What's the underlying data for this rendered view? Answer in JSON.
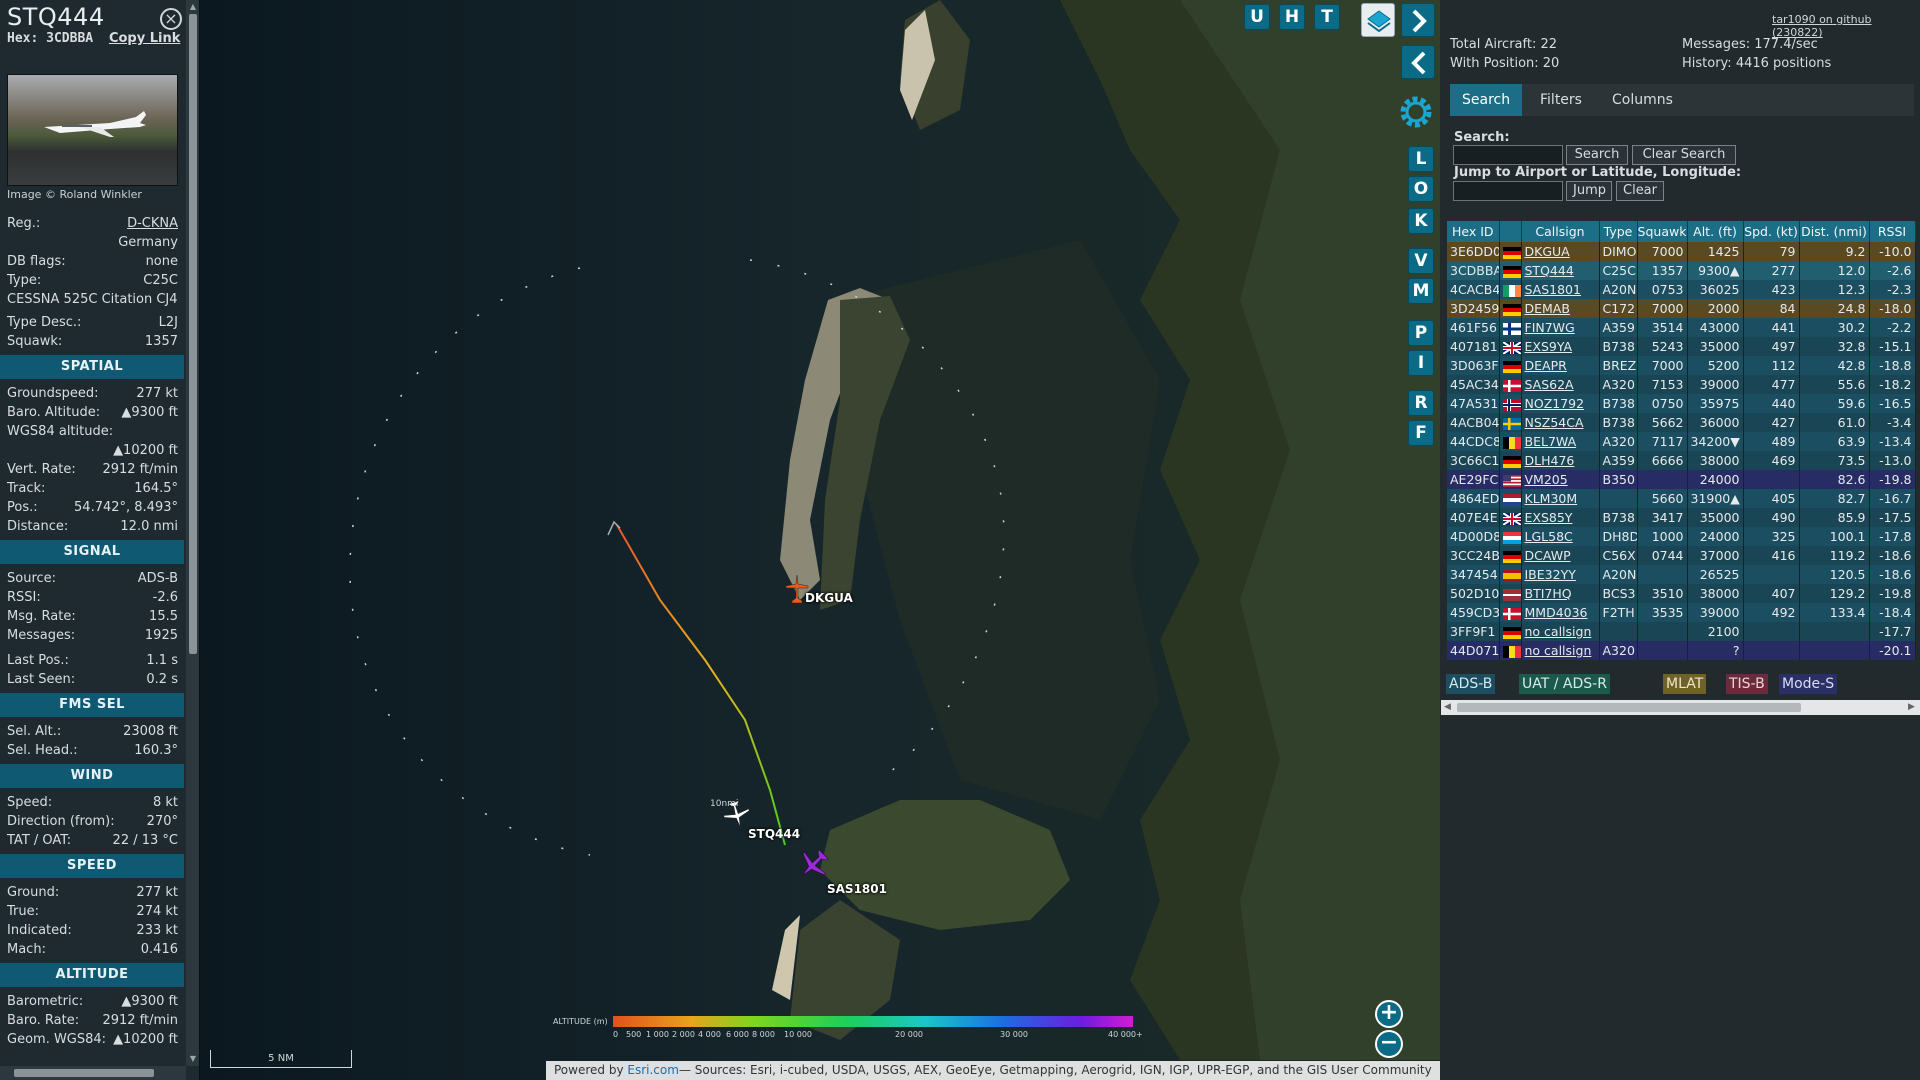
{
  "info": {
    "callsign": "STQ444",
    "hex_label": "Hex:",
    "hex": "3CDBBA",
    "copy_link": "Copy Link",
    "photo_credit": "Image © Roland Winkler",
    "rows_top": [
      {
        "k": "Reg.:",
        "v": "D-CKNA",
        "link": true
      },
      {
        "k": "",
        "v": "Germany"
      },
      {
        "k": "DB flags:",
        "v": "none"
      },
      {
        "k": "Type:",
        "v": "C25C"
      },
      {
        "k": "CESSNA 525C Citation CJ4",
        "v": ""
      },
      {
        "k": "Type Desc.:",
        "v": "L2J"
      },
      {
        "k": "Squawk:",
        "v": "1357"
      }
    ],
    "sections": [
      {
        "title": "SPATIAL",
        "rows": [
          {
            "k": "Groundspeed:",
            "v": "277 kt"
          },
          {
            "k": "Baro. Altitude:",
            "v": "▲9300 ft"
          },
          {
            "k": "WGS84 altitude:",
            "v": ""
          },
          {
            "k": "",
            "v": "▲10200 ft"
          },
          {
            "k": "Vert. Rate:",
            "v": "2912 ft/min"
          },
          {
            "k": "Track:",
            "v": "164.5°"
          },
          {
            "k": "Pos.:",
            "v": "54.742°, 8.493°"
          },
          {
            "k": "Distance:",
            "v": "12.0 nmi"
          }
        ]
      },
      {
        "title": "SIGNAL",
        "rows": [
          {
            "k": "Source:",
            "v": "ADS-B"
          },
          {
            "k": "RSSI:",
            "v": "-2.6"
          },
          {
            "k": "Msg. Rate:",
            "v": "15.5"
          },
          {
            "k": "Messages:",
            "v": "1925"
          },
          {
            "k": "Last Pos.:",
            "v": "1.1 s"
          },
          {
            "k": "Last Seen:",
            "v": "0.2 s"
          }
        ]
      },
      {
        "title": "FMS SEL",
        "rows": [
          {
            "k": "Sel. Alt.:",
            "v": "23008 ft"
          },
          {
            "k": "Sel. Head.:",
            "v": "160.3°"
          }
        ]
      },
      {
        "title": "WIND",
        "rows": [
          {
            "k": "Speed:",
            "v": "8 kt"
          },
          {
            "k": "Direction (from):",
            "v": "270°"
          },
          {
            "k": "TAT / OAT:",
            "v": "22 / 13 °C"
          }
        ]
      },
      {
        "title": "SPEED",
        "rows": [
          {
            "k": "Ground:",
            "v": "277 kt"
          },
          {
            "k": "True:",
            "v": "274 kt"
          },
          {
            "k": "Indicated:",
            "v": "233 kt"
          },
          {
            "k": "Mach:",
            "v": "0.416"
          }
        ]
      },
      {
        "title": "ALTITUDE",
        "rows": [
          {
            "k": "Barometric:",
            "v": "▲9300 ft"
          },
          {
            "k": "Baro. Rate:",
            "v": "2912 ft/min"
          },
          {
            "k": "Geom. WGS84:",
            "v": "▲10200 ft"
          }
        ]
      }
    ]
  },
  "map": {
    "top_buttons": [
      "U",
      "H",
      "T"
    ],
    "side_buttons": [
      "L",
      "O",
      "K",
      "V",
      "M",
      "P",
      "I",
      "R",
      "F"
    ],
    "aircraft_labels": {
      "dkgua": "DKGUA",
      "stq444": "STQ444",
      "sas1801": "SAS1801"
    },
    "range_label": "10nmi",
    "scale": "5 NM",
    "altitude_legend_title": "ALTITUDE (m)",
    "altitude_ticks": [
      "0",
      "500",
      "1 000",
      "2 000",
      "4 000",
      "6 000",
      "8 000",
      "10 000",
      "20 000",
      "30 000",
      "40 000+"
    ],
    "attribution_prefix": "Powered by ",
    "attribution_link": "Esri.com",
    "attribution_rest": "— Sources: Esri, i-cubed, USDA, USGS, AEX, GeoEye, Getmapping, Aerogrid, IGN, IGP, UPR-EGP, and the GIS User Community",
    "zoom_in": "+",
    "zoom_out": "−",
    "colors": {
      "track_start": "#e8552a",
      "track_mid": "#e7b21c",
      "track_end": "#3fd11c",
      "dkgua_icon": "#e85a22",
      "sas_icon": "#9a2bd6"
    }
  },
  "right": {
    "github_link": "tar1090 on github (230822)",
    "total_aircraft": "Total Aircraft: 22",
    "with_position": "With Position: 20",
    "messages": "Messages: 177.4/sec",
    "history": "History: 4416 positions",
    "tabs": [
      "Search",
      "Filters",
      "Columns"
    ],
    "search_label": "Search:",
    "search_button": "Search",
    "clear_search_button": "Clear Search",
    "jump_label": "Jump to Airport or Latitude, Longitude:",
    "jump_button": "Jump",
    "clear_button": "Clear",
    "columns": [
      "Hex ID",
      "",
      "Callsign",
      "Type",
      "Squawk",
      "Alt. (ft)",
      "Spd. (kt)",
      "Dist. (nmi)",
      "RSSI"
    ],
    "rows": [
      {
        "hex": "3E6DD0",
        "flag": "de",
        "cs": "DKGUA",
        "type": "DIMO",
        "sq": "7000",
        "alt": "1425",
        "spd": "79",
        "dist": "9.2",
        "rssi": "-10.0",
        "cls": "other"
      },
      {
        "hex": "3CDBBA",
        "flag": "de",
        "cs": "STQ444",
        "type": "C25C",
        "sq": "1357",
        "alt": "9300▲",
        "spd": "277",
        "dist": "12.0",
        "rssi": "-2.6",
        "cls": "sel"
      },
      {
        "hex": "4CACB4",
        "flag": "ie",
        "cs": "SAS1801",
        "type": "A20N",
        "sq": "0753",
        "alt": "36025",
        "spd": "423",
        "dist": "12.3",
        "rssi": "-2.3",
        "cls": "adsb"
      },
      {
        "hex": "3D2459",
        "flag": "de",
        "cs": "DEMAB",
        "type": "C172",
        "sq": "7000",
        "alt": "2000",
        "spd": "84",
        "dist": "24.8",
        "rssi": "-18.0",
        "cls": "other"
      },
      {
        "hex": "461F56",
        "flag": "fi",
        "cs": "FIN7WG",
        "type": "A359",
        "sq": "3514",
        "alt": "43000",
        "spd": "441",
        "dist": "30.2",
        "rssi": "-2.2",
        "cls": "adsb"
      },
      {
        "hex": "407181",
        "flag": "gb",
        "cs": "EXS9YA",
        "type": "B738",
        "sq": "5243",
        "alt": "35000",
        "spd": "497",
        "dist": "32.8",
        "rssi": "-15.1",
        "cls": "adsb alt"
      },
      {
        "hex": "3D063F",
        "flag": "de",
        "cs": "DEAPR",
        "type": "BREZ",
        "sq": "7000",
        "alt": "5200",
        "spd": "112",
        "dist": "42.8",
        "rssi": "-18.8",
        "cls": "adsb"
      },
      {
        "hex": "45AC34",
        "flag": "dk",
        "cs": "SAS62A",
        "type": "A320",
        "sq": "7153",
        "alt": "39000",
        "spd": "477",
        "dist": "55.6",
        "rssi": "-18.2",
        "cls": "adsb alt"
      },
      {
        "hex": "47A531",
        "flag": "no",
        "cs": "NOZ1792",
        "type": "B738",
        "sq": "0750",
        "alt": "35975",
        "spd": "440",
        "dist": "59.6",
        "rssi": "-16.5",
        "cls": "adsb"
      },
      {
        "hex": "4ACB04",
        "flag": "se",
        "cs": "NSZ54CA",
        "type": "B738",
        "sq": "5662",
        "alt": "36000",
        "spd": "427",
        "dist": "61.0",
        "rssi": "-3.4",
        "cls": "adsb alt"
      },
      {
        "hex": "44CDC8",
        "flag": "be",
        "cs": "BEL7WA",
        "type": "A320",
        "sq": "7117",
        "alt": "34200▼",
        "spd": "489",
        "dist": "63.9",
        "rssi": "-13.4",
        "cls": "adsb"
      },
      {
        "hex": "3C66C1",
        "flag": "de",
        "cs": "DLH476",
        "type": "A359",
        "sq": "6666",
        "alt": "38000",
        "spd": "469",
        "dist": "73.5",
        "rssi": "-13.0",
        "cls": "adsb alt"
      },
      {
        "hex": "AE29FC",
        "flag": "us",
        "cs": "VM205",
        "type": "B350",
        "sq": "",
        "alt": "24000",
        "spd": "",
        "dist": "82.6",
        "rssi": "-19.8",
        "cls": "uat"
      },
      {
        "hex": "4864ED",
        "flag": "nl",
        "cs": "KLM30M",
        "type": "",
        "sq": "5660",
        "alt": "31900▲",
        "spd": "405",
        "dist": "82.7",
        "rssi": "-16.7",
        "cls": "adsb"
      },
      {
        "hex": "407E4E",
        "flag": "gb",
        "cs": "EXS85Y",
        "type": "B738",
        "sq": "3417",
        "alt": "35000",
        "spd": "490",
        "dist": "85.9",
        "rssi": "-17.5",
        "cls": "adsb alt"
      },
      {
        "hex": "4D00D8",
        "flag": "lu",
        "cs": "LGL58C",
        "type": "DH8D",
        "sq": "1000",
        "alt": "24000",
        "spd": "325",
        "dist": "100.1",
        "rssi": "-17.8",
        "cls": "adsb"
      },
      {
        "hex": "3CC24B",
        "flag": "de",
        "cs": "DCAWP",
        "type": "C56X",
        "sq": "0744",
        "alt": "37000",
        "spd": "416",
        "dist": "119.2",
        "rssi": "-18.6",
        "cls": "adsb alt"
      },
      {
        "hex": "347454",
        "flag": "es",
        "cs": "IBE32YY",
        "type": "A20N",
        "sq": "",
        "alt": "26525",
        "spd": "",
        "dist": "120.5",
        "rssi": "-18.6",
        "cls": "adsb"
      },
      {
        "hex": "502D10",
        "flag": "lv",
        "cs": "BTI7HQ",
        "type": "BCS3",
        "sq": "3510",
        "alt": "38000",
        "spd": "407",
        "dist": "129.2",
        "rssi": "-19.8",
        "cls": "adsb alt"
      },
      {
        "hex": "459CD3",
        "flag": "dk",
        "cs": "MMD4036",
        "type": "F2TH",
        "sq": "3535",
        "alt": "39000",
        "spd": "492",
        "dist": "133.4",
        "rssi": "-18.4",
        "cls": "adsb"
      },
      {
        "hex": "3FF9F1",
        "flag": "de",
        "cs": "no callsign",
        "type": "",
        "sq": "",
        "alt": "2100",
        "spd": "",
        "dist": "",
        "rssi": "-17.7",
        "cls": "adsb alt"
      },
      {
        "hex": "44D071",
        "flag": "be",
        "cs": "no callsign",
        "type": "A320",
        "sq": "",
        "alt": "?",
        "spd": "",
        "dist": "",
        "rssi": "-20.1",
        "cls": "uat"
      }
    ],
    "legend": [
      {
        "label": "ADS-B",
        "bg": "#1b4e60",
        "fg": "#d8e8ee"
      },
      {
        "label": "UAT / ADS-R",
        "bg": "#1b5a4a",
        "fg": "#d8e8ee"
      },
      {
        "label": "MLAT",
        "bg": "#6e6226",
        "fg": "#f0e6c0"
      },
      {
        "label": "TIS-B",
        "bg": "#6b2b3a",
        "fg": "#f0d0d8"
      },
      {
        "label": "Mode-S",
        "bg": "#2a2f66",
        "fg": "#d8dcf4"
      }
    ]
  }
}
